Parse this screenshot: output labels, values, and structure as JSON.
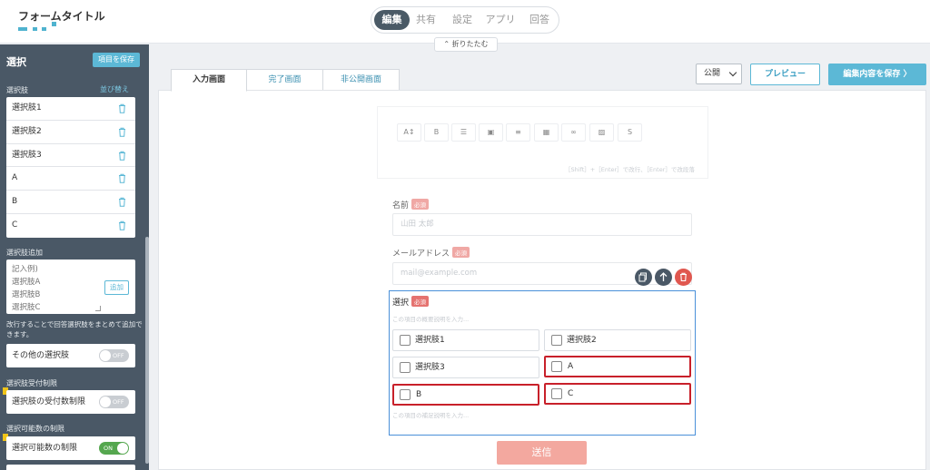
{
  "header": {
    "form_title": "フォームタイトル",
    "tabs": [
      {
        "label": "編集",
        "active": true
      },
      {
        "label": "共有",
        "active": false
      },
      {
        "label": "設定",
        "active": false
      },
      {
        "label": "アプリ",
        "active": false
      },
      {
        "label": "回答",
        "active": false
      }
    ],
    "collapse_label": "折りたたむ"
  },
  "sidebar": {
    "title": "選択",
    "save_label": "項目を保存",
    "options_label": "選択肢",
    "sort_label": "並び替え",
    "options": [
      "選択肢1",
      "選択肢2",
      "選択肢3",
      "A",
      "B",
      "C"
    ],
    "add_section_label": "選択肢追加",
    "add_placeholder": "記入例)\n選択肢A\n選択肢B\n選択肢C",
    "add_button": "追加",
    "add_help": "改行することで回答選択肢をまとめて追加できます。",
    "other_option_label": "その他の選択肢",
    "other_option_state": "OFF",
    "limit_section_label": "選択肢受付制限",
    "limit_label": "選択肢の受付数制限",
    "limit_state": "OFF",
    "count_section_label": "選択可能数の制限",
    "count_label": "選択可能数の制限",
    "count_state": "ON"
  },
  "main": {
    "page_tabs": [
      {
        "label": "入力画面",
        "active": true
      },
      {
        "label": "完了画面",
        "active": false
      },
      {
        "label": "非公開画面",
        "active": false
      }
    ],
    "visibility": "公開",
    "preview_label": "プレビュー",
    "save_label": "編集内容を保存 〉",
    "editor_hint": "［Shift］+［Enter］で改行、［Enter］で改段落",
    "fields": {
      "name": {
        "label": "名前",
        "required": "必須",
        "placeholder": "山田 太郎"
      },
      "email": {
        "label": "メールアドレス",
        "required": "必須",
        "placeholder": "mail@example.com"
      }
    },
    "select_field": {
      "label": "選択",
      "required": "必須",
      "description_placeholder": "この項目の概要説明を入力...",
      "choices": [
        "選択肢1",
        "選択肢2",
        "選択肢3",
        "A",
        "B",
        "C"
      ],
      "footer_placeholder": "この項目の補足説明を入力..."
    },
    "submit_label": "送信"
  },
  "colors": {
    "accent": "#5cb8d6",
    "sidebar_bg": "#4a5866",
    "required": "#e57370",
    "highlight": "#c8202a",
    "selected_border": "#4a90d9",
    "toggle_on": "#55a74f"
  }
}
